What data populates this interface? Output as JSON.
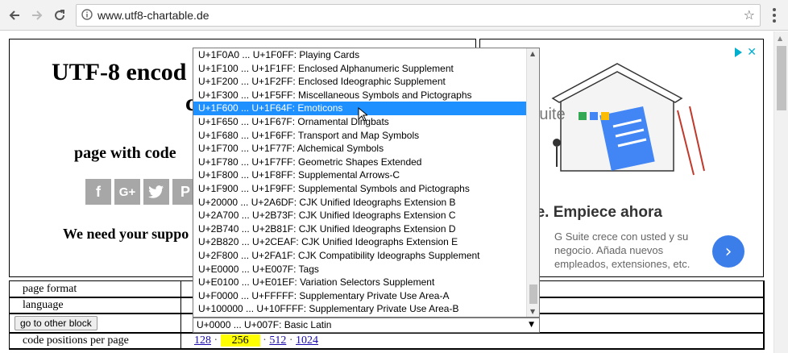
{
  "browser": {
    "url": "www.utf8-chartable.de"
  },
  "header": {
    "title_line1": "UTF-8 encod",
    "title_line2": "c",
    "subtitle": "page with code",
    "support": "We need your suppo",
    "social": [
      "f",
      "G+",
      "t",
      "P"
    ]
  },
  "ad": {
    "suite_text": "Suite",
    "headline": "ite. Empiece ahora",
    "body": "G Suite crece con usted y su negocio. Añada nuevos empleados, extensiones, etc.",
    "accent_color": "#3b7de9",
    "adchoice_color": "#00aecd"
  },
  "settings": {
    "page_format_label": "page format",
    "language_label": "language",
    "go_button": "go to other block",
    "code_positions_label": "code positions per page",
    "per_page_options": [
      "128",
      "256",
      "512",
      "1024"
    ],
    "per_page_selected": "256",
    "separator": "·"
  },
  "block_select": {
    "selected_value": "U+0000 ... U+007F: Basic Latin",
    "highlighted_option": "U+1F600 ... U+1F64F: Emoticons",
    "options": [
      "U+1F0A0 ... U+1F0FF: Playing Cards",
      "U+1F100 ... U+1F1FF: Enclosed Alphanumeric Supplement",
      "U+1F200 ... U+1F2FF: Enclosed Ideographic Supplement",
      "U+1F300 ... U+1F5FF: Miscellaneous Symbols and Pictographs",
      "U+1F600 ... U+1F64F: Emoticons",
      "U+1F650 ... U+1F67F: Ornamental Dingbats",
      "U+1F680 ... U+1F6FF: Transport and Map Symbols",
      "U+1F700 ... U+1F77F: Alchemical Symbols",
      "U+1F780 ... U+1F7FF: Geometric Shapes Extended",
      "U+1F800 ... U+1F8FF: Supplemental Arrows-C",
      "U+1F900 ... U+1F9FF: Supplemental Symbols and Pictographs",
      "U+20000 ... U+2A6DF: CJK Unified Ideographs Extension B",
      "U+2A700 ... U+2B73F: CJK Unified Ideographs Extension C",
      "U+2B740 ... U+2B81F: CJK Unified Ideographs Extension D",
      "U+2B820 ... U+2CEAF: CJK Unified Ideographs Extension E",
      "U+2F800 ... U+2FA1F: CJK Compatibility Ideographs Supplement",
      "U+E0000 ... U+E007F: Tags",
      "U+E0100 ... U+E01EF: Variation Selectors Supplement",
      "U+F0000 ... U+FFFFF: Supplementary Private Use Area-A",
      "U+100000 ... U+10FFFF: Supplementary Private Use Area-B"
    ],
    "selection_color": "#1e90ff"
  },
  "icons": {
    "back": "back-arrow-icon",
    "forward": "forward-arrow-icon",
    "reload": "reload-icon",
    "info": "info-icon",
    "bookmark": "star-icon",
    "menu": "kebab-menu-icon",
    "cursor": "mouse-pointer-icon"
  }
}
